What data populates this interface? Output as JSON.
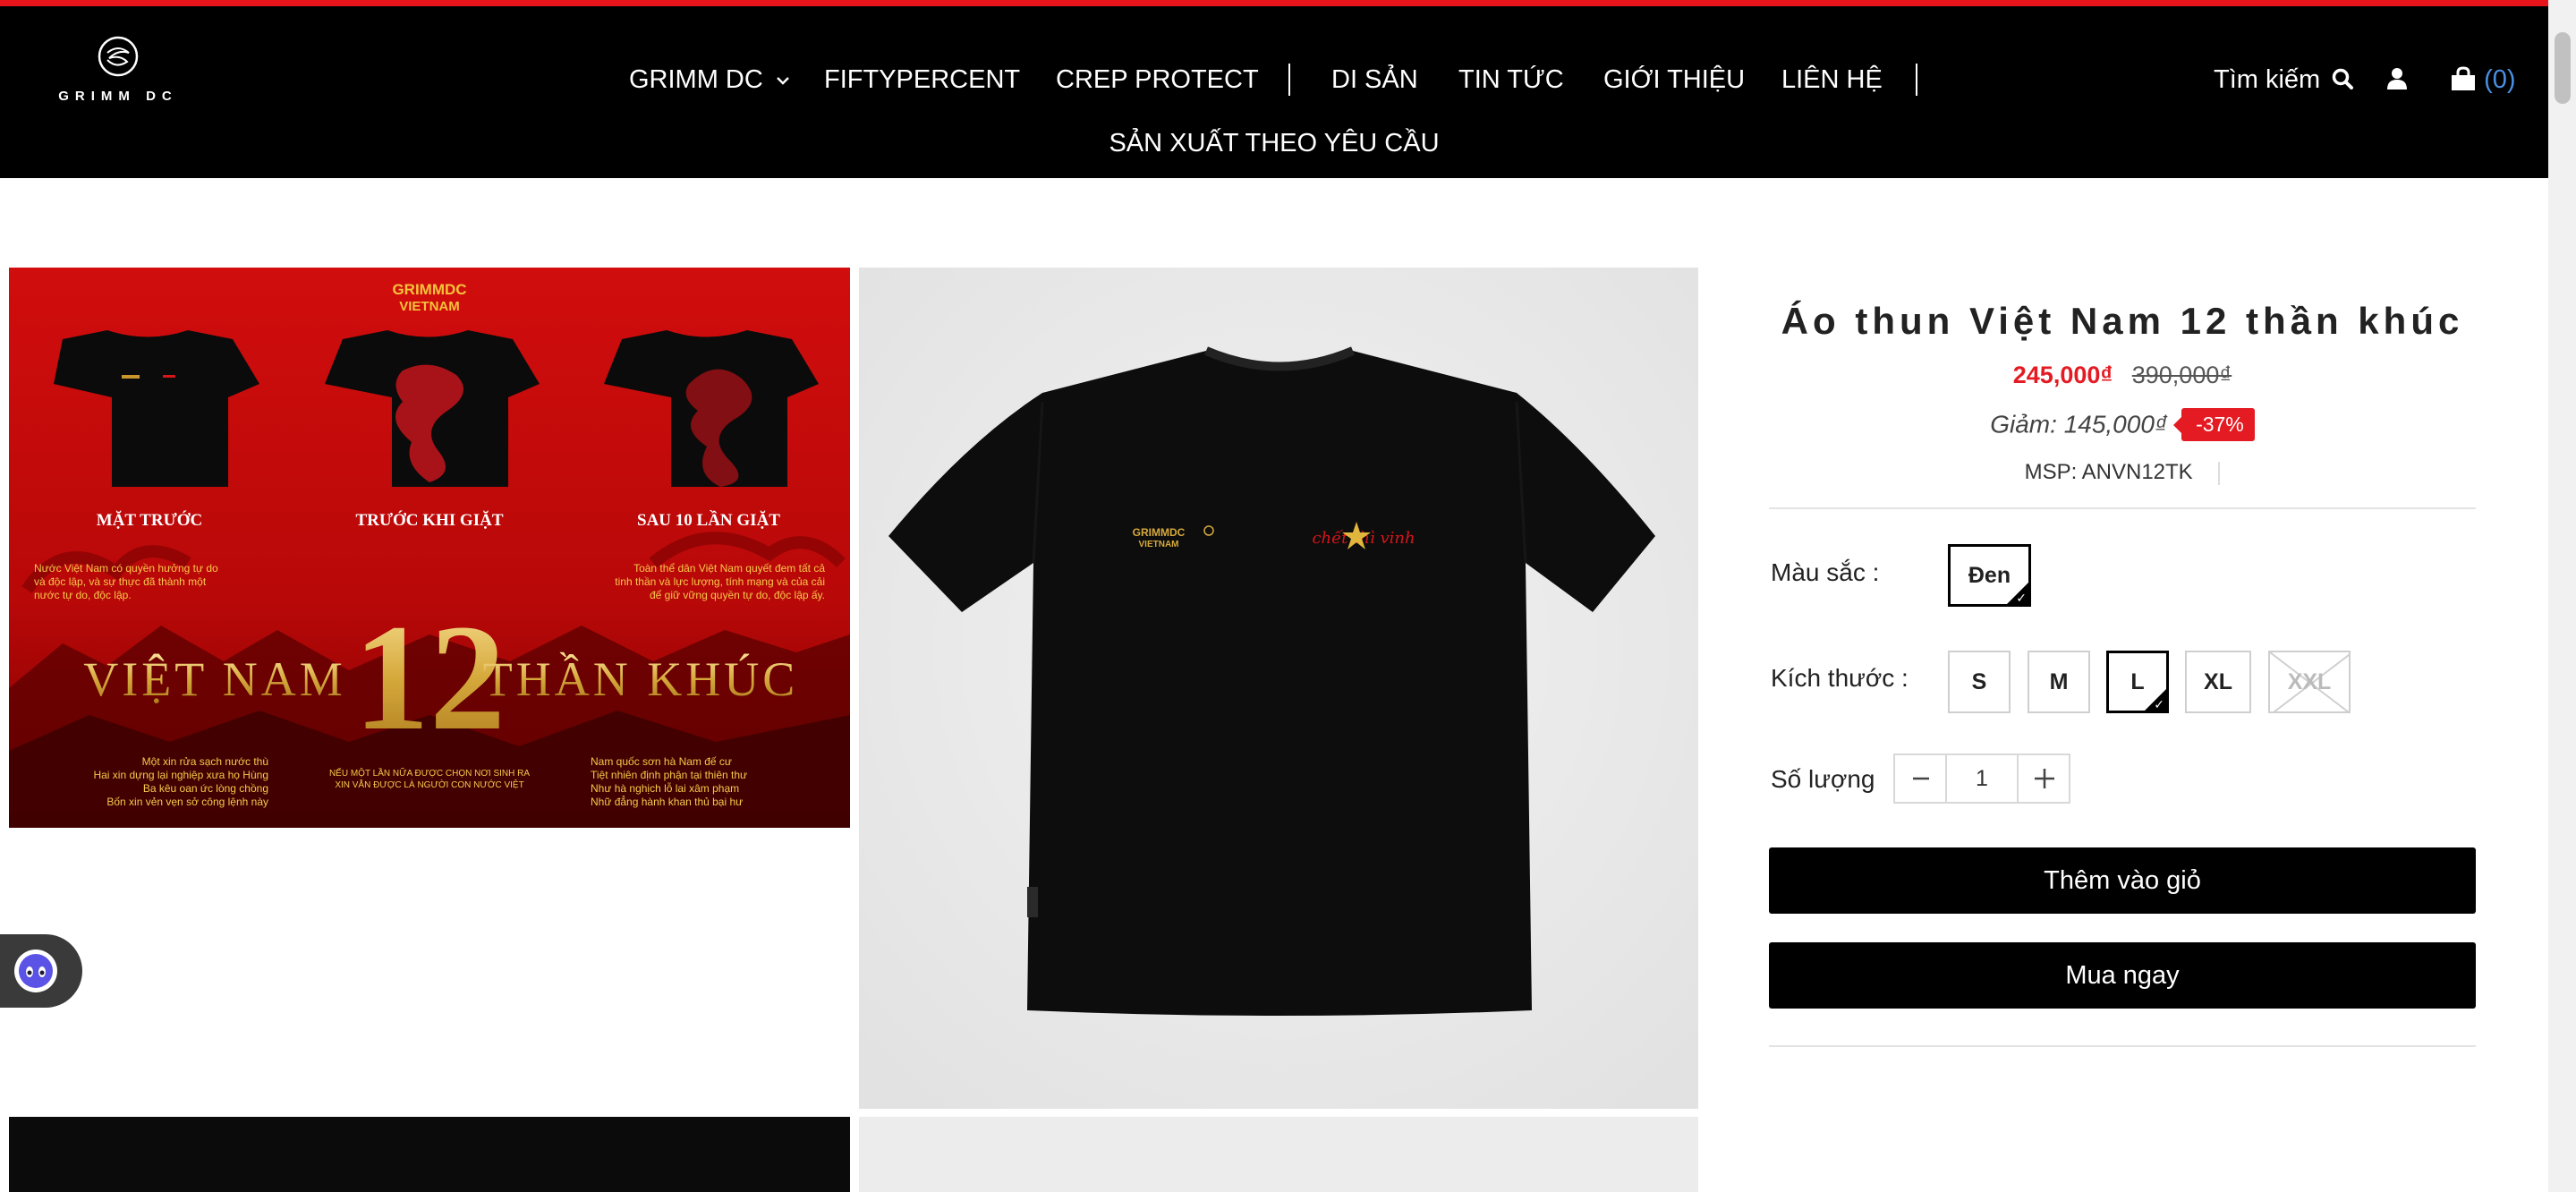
{
  "brand": {
    "logo_text": "GRIMM DC"
  },
  "nav": {
    "items": [
      {
        "label": "GRIMM DC",
        "has_dropdown": true
      },
      {
        "label": "FIFTYPERCENT"
      },
      {
        "label": "CREP PROTECT"
      },
      {
        "label": "DI SẢN"
      },
      {
        "label": "TIN TỨC"
      },
      {
        "label": "GIỚI THIỆU"
      },
      {
        "label": "LIÊN HỆ"
      }
    ],
    "second_row": "SẢN XUẤT THEO YÊU CẦU",
    "search_label": "Tìm kiếm",
    "cart_open": "(",
    "cart_count": "0",
    "cart_close": ")"
  },
  "gallery": {
    "poster": {
      "brand_line1": "GRIMMDC",
      "brand_line2": "VIETNAM",
      "shirt_captions": [
        "MẶT TRƯỚC",
        "TRƯỚC KHI GIẶT",
        "SAU 10 LẦN GIẶT"
      ],
      "headline_left": "VIỆT NAM",
      "headline_number": "12",
      "headline_right": "THẦN KHÚC",
      "verse_top_left": [
        "Nước Việt Nam có quyền hưởng tự do",
        "và độc lập, và sự thực đã thành một",
        "nước tự do, độc lập."
      ],
      "verse_top_right": [
        "Toàn thể dân Việt Nam quyết đem tất cả",
        "tinh thần và lực lượng, tính mạng và của cải",
        "để giữ vững quyền tự do, độc lập ấy."
      ],
      "verse_bottom_left": [
        "Một xin rửa sạch nước thù",
        "Hai xin dựng lại nghiệp xưa họ Hùng",
        "Ba kêu oan ức lòng chồng",
        "Bốn xin vẻn vẹn sở công lệnh này"
      ],
      "verse_bottom_center": [
        "NẾU MỘT LẦN NỮA ĐƯỢC CHỌN NƠI SINH RA",
        "XIN VẪN ĐƯỢC LÀ NGƯỜI CON NƯỚC VIỆT"
      ],
      "verse_bottom_right": [
        "Nam quốc sơn hà Nam đế cư",
        "Tiệt nhiên định phận tại thiên thư",
        "Như hà nghịch lỗ lai xâm phạm",
        "Nhữ đẳng hành khan thủ bại hư"
      ]
    },
    "tee_print": {
      "left_line1": "GRIMMDC",
      "left_line2": "VIETNAM",
      "right_script": "chết thì vinh"
    }
  },
  "product": {
    "title": "Áo thun Việt Nam 12 thần khúc",
    "price": "245,000₫",
    "compare_price": "390,000₫",
    "save_text": "Giảm: 145,000₫",
    "discount_badge": "-37%",
    "sku_text": "MSP: ANVN12TK",
    "color_label": "Màu sắc :",
    "colors": [
      {
        "label": "Đen",
        "selected": true
      }
    ],
    "size_label": "Kích thước :",
    "sizes": [
      {
        "label": "S",
        "selected": false,
        "available": true
      },
      {
        "label": "M",
        "selected": false,
        "available": true
      },
      {
        "label": "L",
        "selected": true,
        "available": true
      },
      {
        "label": "XL",
        "selected": false,
        "available": true
      },
      {
        "label": "XXL",
        "selected": false,
        "available": false
      }
    ],
    "qty_label": "Số lượng",
    "qty_value": "1",
    "add_to_cart": "Thêm vào giỏ",
    "buy_now": "Mua ngay"
  },
  "colors": {
    "accent_red": "#e41b23",
    "header_bg": "#000000",
    "cart_count": "#4a90e2"
  }
}
